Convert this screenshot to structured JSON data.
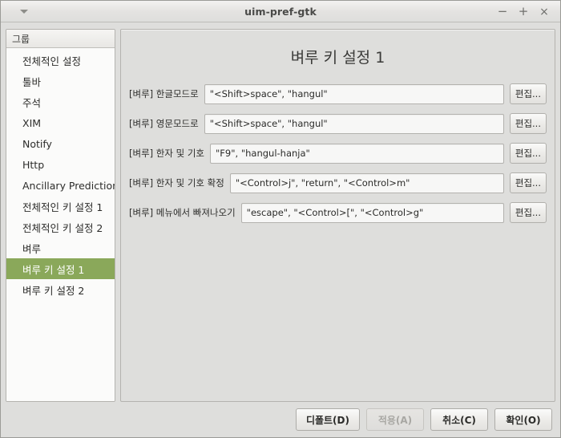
{
  "window": {
    "title": "uim-pref-gtk",
    "menu_icon": "window-menu-triangle-icon",
    "minimize_label": "−",
    "maximize_label": "+",
    "close_label": "×"
  },
  "sidebar": {
    "header": "그룹",
    "items": [
      {
        "label": "전체적인 설정",
        "selected": false
      },
      {
        "label": "툴바",
        "selected": false
      },
      {
        "label": "주석",
        "selected": false
      },
      {
        "label": "XIM",
        "selected": false
      },
      {
        "label": "Notify",
        "selected": false
      },
      {
        "label": "Http",
        "selected": false
      },
      {
        "label": "Ancillary Prediction",
        "selected": false
      },
      {
        "label": "전체적인 키 설정 1",
        "selected": false
      },
      {
        "label": "전체적인 키 설정 2",
        "selected": false
      },
      {
        "label": "벼루",
        "selected": false
      },
      {
        "label": "벼루 키 설정 1",
        "selected": true
      },
      {
        "label": "벼루 키 설정 2",
        "selected": false
      }
    ]
  },
  "main": {
    "title": "벼루 키 설정 1",
    "edit_button_label": "편집...",
    "rows": [
      {
        "label": "[벼루] 한글모드로",
        "value": "\"<Shift>space\", \"hangul\""
      },
      {
        "label": "[벼루] 영문모드로",
        "value": "\"<Shift>space\", \"hangul\""
      },
      {
        "label": "[벼루] 한자 및 기호",
        "value": "\"F9\", \"hangul-hanja\""
      },
      {
        "label": "[벼루] 한자 및 기호 확정",
        "value": "\"<Control>j\", \"return\", \"<Control>m\""
      },
      {
        "label": "[벼루] 메뉴에서 빠져나오기",
        "value": "\"escape\", \"<Control>[\", \"<Control>g\""
      }
    ]
  },
  "footer": {
    "default_label": "디폴트(D)",
    "apply_label": "적용(A)",
    "apply_disabled": true,
    "cancel_label": "취소(C)",
    "ok_label": "확인(O)"
  },
  "colors": {
    "selection": "#8aa85a",
    "window_bg": "#dededc",
    "panel_bg": "#dededc",
    "list_bg": "#fbfbfa",
    "field_bg": "#f7f7f6"
  }
}
